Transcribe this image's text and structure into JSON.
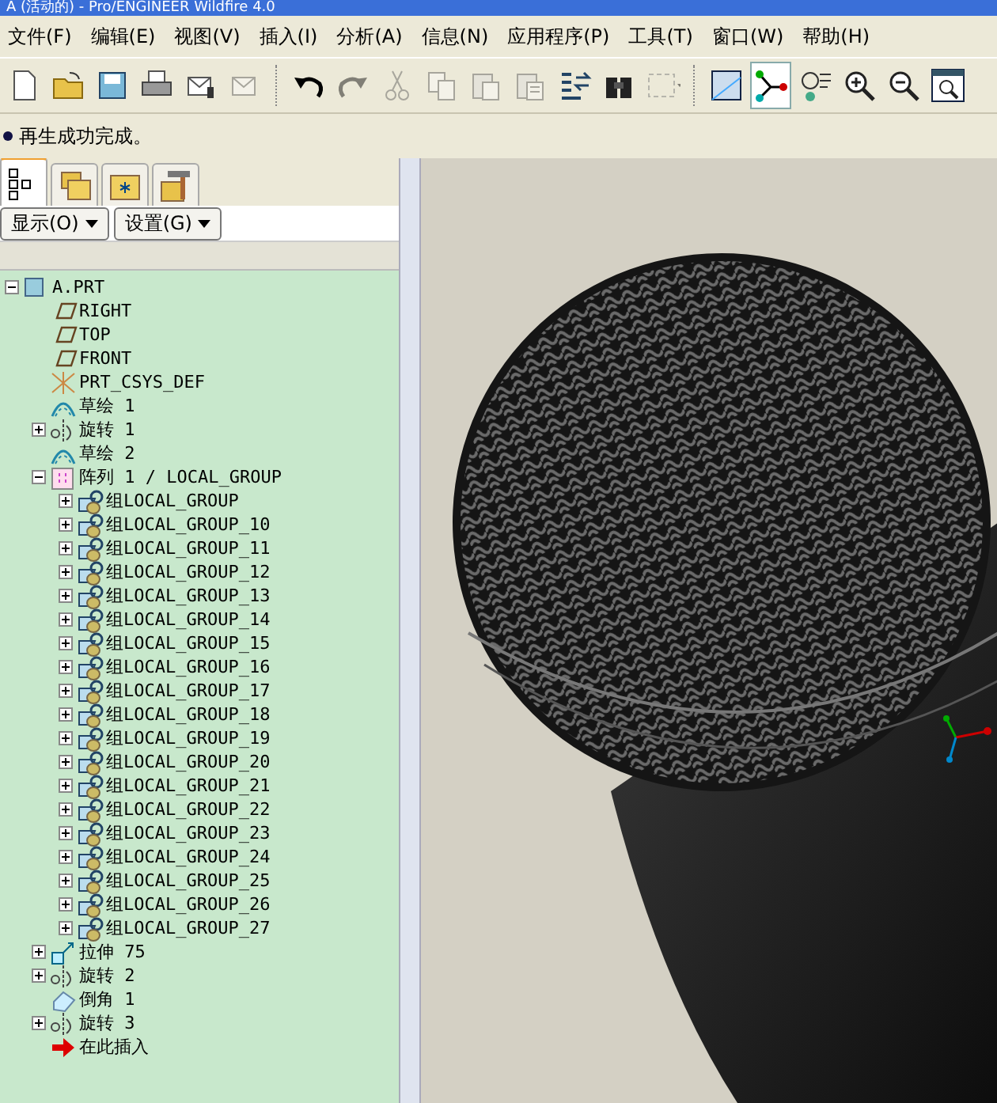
{
  "window": {
    "title": "A (活动的) - Pro/ENGINEER Wildfire 4.0"
  },
  "menu": [
    "文件(F)",
    "编辑(E)",
    "视图(V)",
    "插入(I)",
    "分析(A)",
    "信息(N)",
    "应用程序(P)",
    "工具(T)",
    "窗口(W)",
    "帮助(H)"
  ],
  "toolbar": [
    {
      "kind": "new",
      "disabled": false,
      "pressed": false
    },
    {
      "kind": "open",
      "disabled": false,
      "pressed": false
    },
    {
      "kind": "save",
      "disabled": false,
      "pressed": false
    },
    {
      "kind": "print",
      "disabled": false,
      "pressed": false
    },
    {
      "kind": "mail",
      "disabled": false,
      "pressed": false
    },
    {
      "kind": "mail-link",
      "disabled": true,
      "pressed": false
    },
    {
      "kind": "sep"
    },
    {
      "kind": "undo",
      "disabled": false,
      "pressed": false
    },
    {
      "kind": "redo",
      "disabled": true,
      "pressed": false
    },
    {
      "kind": "cut",
      "disabled": true,
      "pressed": false
    },
    {
      "kind": "copy",
      "disabled": true,
      "pressed": false
    },
    {
      "kind": "paste",
      "disabled": true,
      "pressed": false
    },
    {
      "kind": "paste-special",
      "disabled": true,
      "pressed": false
    },
    {
      "kind": "regenerate",
      "disabled": false,
      "pressed": false
    },
    {
      "kind": "find",
      "disabled": false,
      "pressed": false
    },
    {
      "kind": "select-box",
      "disabled": true,
      "pressed": false
    },
    {
      "kind": "sep"
    },
    {
      "kind": "plane",
      "disabled": false,
      "pressed": false
    },
    {
      "kind": "axis",
      "disabled": false,
      "pressed": true
    },
    {
      "kind": "points",
      "disabled": false,
      "pressed": false
    },
    {
      "kind": "zoom-in",
      "disabled": false,
      "pressed": false
    },
    {
      "kind": "zoom-out",
      "disabled": false,
      "pressed": false
    },
    {
      "kind": "refit",
      "disabled": false,
      "pressed": false
    }
  ],
  "message": "再生成功完成。",
  "panel_tabs": [
    {
      "kind": "tree",
      "selected": true
    },
    {
      "kind": "folders",
      "selected": false
    },
    {
      "kind": "favorites",
      "selected": false
    },
    {
      "kind": "tools",
      "selected": false
    }
  ],
  "panel_buttons": [
    "显示(O)",
    "设置(G)"
  ],
  "tree": [
    {
      "label": "A.PRT",
      "kind": "part",
      "expanded": true,
      "children": [
        {
          "label": "RIGHT",
          "kind": "plane"
        },
        {
          "label": "TOP",
          "kind": "plane"
        },
        {
          "label": "FRONT",
          "kind": "plane"
        },
        {
          "label": "PRT_CSYS_DEF",
          "kind": "csys"
        },
        {
          "label": "草绘 1",
          "kind": "sketch"
        },
        {
          "label": "旋转 1",
          "kind": "revolve",
          "expanded": false
        },
        {
          "label": "草绘 2",
          "kind": "sketch"
        },
        {
          "label": "阵列 1 / LOCAL_GROUP",
          "kind": "pattern",
          "expanded": true,
          "children": [
            {
              "label": "组LOCAL_GROUP",
              "kind": "group",
              "expanded": false
            },
            {
              "label": "组LOCAL_GROUP_10",
              "kind": "group",
              "expanded": false
            },
            {
              "label": "组LOCAL_GROUP_11",
              "kind": "group",
              "expanded": false
            },
            {
              "label": "组LOCAL_GROUP_12",
              "kind": "group",
              "expanded": false
            },
            {
              "label": "组LOCAL_GROUP_13",
              "kind": "group",
              "expanded": false
            },
            {
              "label": "组LOCAL_GROUP_14",
              "kind": "group",
              "expanded": false
            },
            {
              "label": "组LOCAL_GROUP_15",
              "kind": "group",
              "expanded": false
            },
            {
              "label": "组LOCAL_GROUP_16",
              "kind": "group",
              "expanded": false
            },
            {
              "label": "组LOCAL_GROUP_17",
              "kind": "group",
              "expanded": false
            },
            {
              "label": "组LOCAL_GROUP_18",
              "kind": "group",
              "expanded": false
            },
            {
              "label": "组LOCAL_GROUP_19",
              "kind": "group",
              "expanded": false
            },
            {
              "label": "组LOCAL_GROUP_20",
              "kind": "group",
              "expanded": false
            },
            {
              "label": "组LOCAL_GROUP_21",
              "kind": "group",
              "expanded": false
            },
            {
              "label": "组LOCAL_GROUP_22",
              "kind": "group",
              "expanded": false
            },
            {
              "label": "组LOCAL_GROUP_23",
              "kind": "group",
              "expanded": false
            },
            {
              "label": "组LOCAL_GROUP_24",
              "kind": "group",
              "expanded": false
            },
            {
              "label": "组LOCAL_GROUP_25",
              "kind": "group",
              "expanded": false
            },
            {
              "label": "组LOCAL_GROUP_26",
              "kind": "group",
              "expanded": false
            },
            {
              "label": "组LOCAL_GROUP_27",
              "kind": "group",
              "expanded": false
            }
          ]
        },
        {
          "label": "拉伸 75",
          "kind": "extrude",
          "expanded": false
        },
        {
          "label": "旋转 2",
          "kind": "revolve",
          "expanded": false
        },
        {
          "label": "倒角 1",
          "kind": "chamfer"
        },
        {
          "label": "旋转 3",
          "kind": "revolve",
          "expanded": false
        },
        {
          "label": "在此插入",
          "kind": "insert"
        }
      ]
    }
  ]
}
